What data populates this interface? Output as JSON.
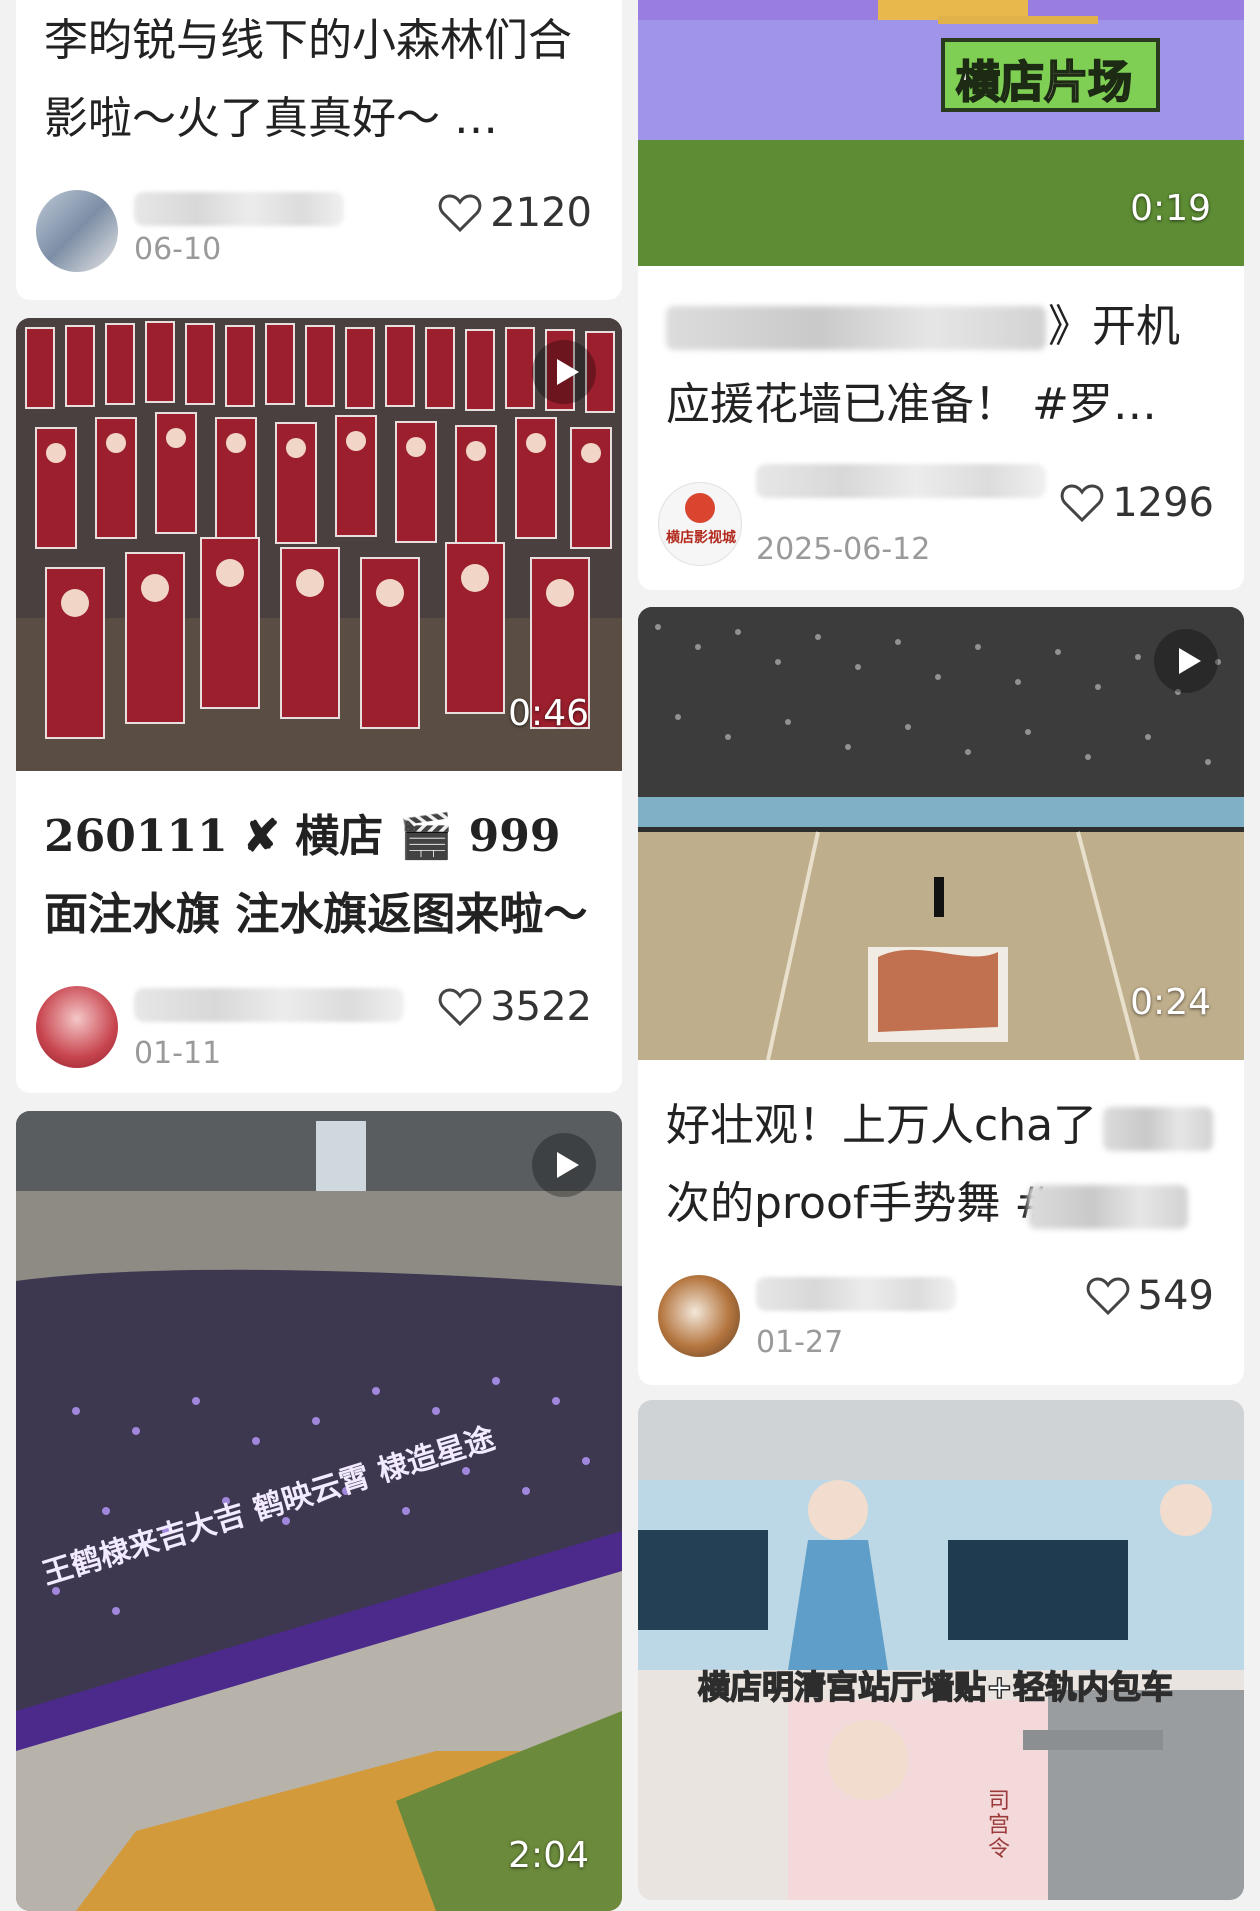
{
  "feed": {
    "left": [
      {
        "title": "李昀锐与线下的小森林们合影啦～火了真真好～ …",
        "date": "06-10",
        "likes": "2120"
      },
      {
        "duration": "0:46",
        "title": "260111 ✘ 横店 🎬 999面注水旗 注水旗返图来啦～ …",
        "date": "01-11",
        "likes": "3522"
      },
      {
        "duration": "2:04",
        "banner_text": "王鹤棣来吉大吉 鹤映云霄 棣造星途"
      }
    ],
    "right": [
      {
        "duration": "0:19",
        "overlay_text": "横店片场",
        "title_visible_end": "》开机",
        "title_line2": "应援花墙已准备！ #罗…",
        "avatar_text": "横店影视城",
        "date": "2025-06-12",
        "likes": "1296"
      },
      {
        "duration": "0:24",
        "title_line1": "好壮观！上万人cha了",
        "title_line2": "次的proof手势舞 #",
        "date": "01-27",
        "likes": "549"
      },
      {
        "caption": "横店明清宫站厅墙贴+轻轨内包车",
        "poster_text": "司宫令"
      }
    ]
  },
  "colors": {
    "background": "#f2f2f2",
    "card": "#ffffff",
    "purple_stage": "#8d78e8",
    "grass": "#5c8a36",
    "banner_red": "#8b1a26"
  }
}
